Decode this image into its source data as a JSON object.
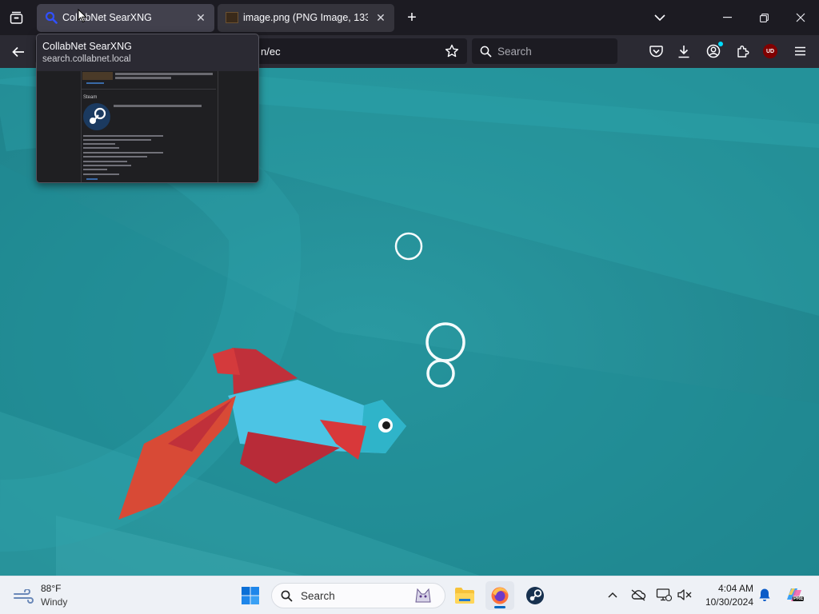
{
  "browser": {
    "tabs": [
      {
        "title": "CollabNet SearXNG",
        "active": true
      },
      {
        "title": "image.png (PNG Image, 1333 ×",
        "active": false
      }
    ],
    "new_tab_label": "+",
    "url_visible": "n/ec",
    "search_placeholder": "Search",
    "icons": [
      "tab-list-icon",
      "back-icon",
      "bookmark-star-icon",
      "search-icon",
      "pocket-icon",
      "downloads-icon",
      "account-icon",
      "extensions-icon",
      "ublock-icon",
      "menu-icon",
      "list-all-tabs-icon",
      "minimize-icon",
      "restore-icon",
      "close-icon"
    ],
    "ublock_label": "UD"
  },
  "tab_preview": {
    "title": "CollabNet SearXNG",
    "url": "search.collabnet.local",
    "thumbnail_heading": "Steam"
  },
  "wallpaper": {
    "colors": {
      "sea": "#23929c",
      "fish_body": "#4cc4e4",
      "fish_fins": "#c0303a",
      "fish_tail": "#d84a36"
    }
  },
  "taskbar": {
    "weather": {
      "temp": "88°F",
      "condition": "Windy"
    },
    "search_placeholder": "Search",
    "clock": {
      "time": "4:04 AM",
      "date": "10/30/2024"
    },
    "apps": [
      "windows-start-icon",
      "file-explorer-icon",
      "firefox-icon",
      "steam-icon"
    ],
    "copilot_badge": "PRE"
  }
}
